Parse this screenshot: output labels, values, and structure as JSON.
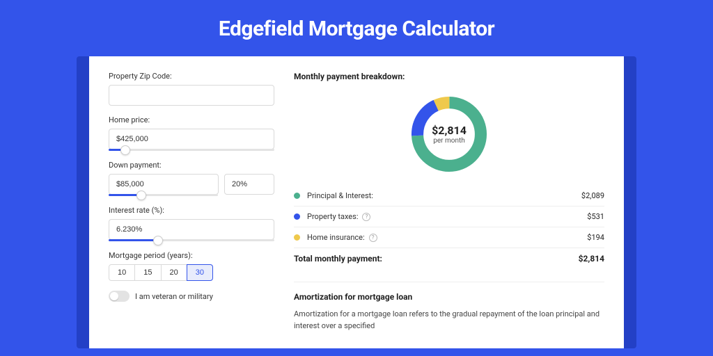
{
  "title": "Edgefield Mortgage Calculator",
  "colors": {
    "principal": "#4bb08e",
    "taxes": "#3354ea",
    "insurance": "#efc94c"
  },
  "form": {
    "zip_label": "Property Zip Code:",
    "zip_value": "",
    "home_price_label": "Home price:",
    "home_price_value": "$425,000",
    "home_price_slider_pct": 10,
    "down_payment_label": "Down payment:",
    "down_payment_value": "$85,000",
    "down_payment_pct": "20%",
    "down_payment_slider_pct": 20,
    "interest_label": "Interest rate (%):",
    "interest_value": "6.230%",
    "interest_slider_pct": 30,
    "period_label": "Mortgage period (years):",
    "period_options": [
      "10",
      "15",
      "20",
      "30"
    ],
    "period_selected": "30",
    "veteran_label": "I am veteran or military"
  },
  "breakdown": {
    "heading": "Monthly payment breakdown:",
    "center_value": "$2,814",
    "center_sub": "per month",
    "items": [
      {
        "label": "Principal & Interest:",
        "value": "$2,089",
        "color": "#4bb08e",
        "help": false
      },
      {
        "label": "Property taxes:",
        "value": "$531",
        "color": "#3354ea",
        "help": true
      },
      {
        "label": "Home insurance:",
        "value": "$194",
        "color": "#efc94c",
        "help": true
      }
    ],
    "total_label": "Total monthly payment:",
    "total_value": "$2,814"
  },
  "amort": {
    "title": "Amortization for mortgage loan",
    "text": "Amortization for a mortgage loan refers to the gradual repayment of the loan principal and interest over a specified"
  },
  "chart_data": {
    "type": "pie",
    "title": "Monthly payment breakdown",
    "series": [
      {
        "name": "Principal & Interest",
        "value": 2089
      },
      {
        "name": "Property taxes",
        "value": 531
      },
      {
        "name": "Home insurance",
        "value": 194
      }
    ],
    "total": 2814,
    "unit": "USD per month"
  }
}
